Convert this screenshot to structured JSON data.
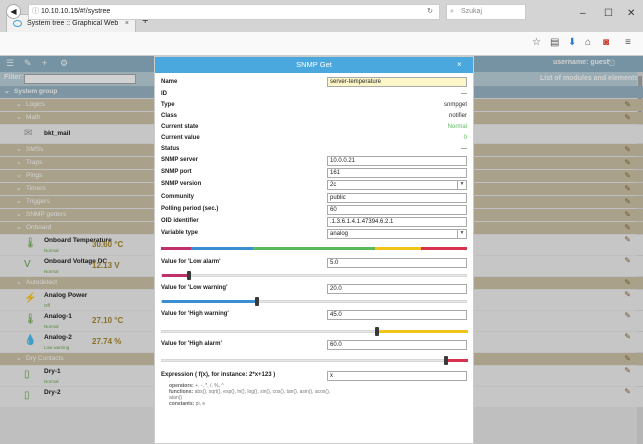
{
  "browser": {
    "tab_title": "System tree :: Graphical Web",
    "tab_close": "×",
    "newtab": "+",
    "url": "10.10.10.15/#!/systree",
    "search_placeholder": "Szukaj",
    "win_min": "–",
    "win_max": "☐",
    "win_close": "✕"
  },
  "app": {
    "username": "username: guest",
    "filter_label": "Filter:",
    "list_header": "List of modules and elements",
    "tree": [
      {
        "kind": "group",
        "label": "System group"
      },
      {
        "kind": "cat",
        "label": "Logics"
      },
      {
        "kind": "cat",
        "label": "Math"
      },
      {
        "kind": "el",
        "label": "bkt_mail"
      },
      {
        "kind": "cat",
        "label": "SMSs"
      },
      {
        "kind": "cat",
        "label": "Traps"
      },
      {
        "kind": "cat",
        "label": "Pings"
      },
      {
        "kind": "cat",
        "label": "Timers"
      },
      {
        "kind": "cat",
        "label": "Triggers"
      },
      {
        "kind": "cat",
        "label": "SNMP getters"
      },
      {
        "kind": "cat",
        "label": "Onboard"
      }
    ],
    "elements": [
      {
        "title": "Onboard Temperature",
        "sub": "Normal",
        "value": "30.60 °C"
      },
      {
        "title": "Onboard Voltage DC",
        "sub": "Normal",
        "value": "12.13 V"
      },
      {
        "cat": "Autodetect"
      },
      {
        "title": "Analog Power",
        "sub": "Off",
        "value": ""
      },
      {
        "title": "Analog-1",
        "sub": "Normal",
        "value": "27.10 °C"
      },
      {
        "title": "Analog-2",
        "sub": "Low warning",
        "value": "27.74 %"
      },
      {
        "cat": "Dry Contacts"
      },
      {
        "title": "Dry-1",
        "sub": "Normal",
        "value": ""
      },
      {
        "title": "Dry-2",
        "sub": "",
        "value": ""
      }
    ]
  },
  "dialog": {
    "title": "SNMP Get",
    "close": "×",
    "name_label": "Name",
    "name_value": "server-temperature",
    "id_label": "ID",
    "id_value": "—",
    "type_label": "Type",
    "type_value": "snmpget",
    "class_label": "Class",
    "class_value": "notifier",
    "state_label": "Current state",
    "state_value": "Normal",
    "curval_label": "Current value",
    "curval_value": "0",
    "status_label": "Status",
    "status_value": "—",
    "server_label": "SNMP server",
    "server_value": "10.0.0.21",
    "port_label": "SNMP port",
    "port_value": "161",
    "version_label": "SNMP version",
    "version_value": "2c",
    "community_label": "Community",
    "community_value": "public",
    "polling_label": "Polling period (sec.)",
    "polling_value": "60",
    "oid_label": "OID identifier",
    "oid_value": ".1.3.6.1.4.1.47394.6.2.1",
    "vartype_label": "Variable type",
    "vartype_value": "analog",
    "low_alarm_label": "Value for 'Low alarm'",
    "low_alarm_value": "5.0",
    "low_warn_label": "Value for 'Low warning'",
    "low_warn_value": "20.0",
    "high_warn_label": "Value for 'High warning'",
    "high_warn_value": "45.0",
    "high_alarm_label": "Value for 'High alarm'",
    "high_alarm_value": "60.0",
    "expr_label": "Expression ( f(x), for instance: 2*x+123 )",
    "expr_value": "x",
    "ops_operators_label": "operators:",
    "ops_operators": "+, -, *, /, %, ^",
    "ops_functions_label": "functions:",
    "ops_functions": "abs(), sqrt(), exp(), ln(), log(), sin(), cos(), tan(), asin(), acos(), atan()",
    "ops_constants_label": "constants:",
    "ops_constants": "pi, e",
    "colors": {
      "red": "#d8324f",
      "green": "#5cb85c",
      "blue": "#3b8ed0",
      "yellow": "#f0c419",
      "magenta": "#c0306a"
    }
  }
}
